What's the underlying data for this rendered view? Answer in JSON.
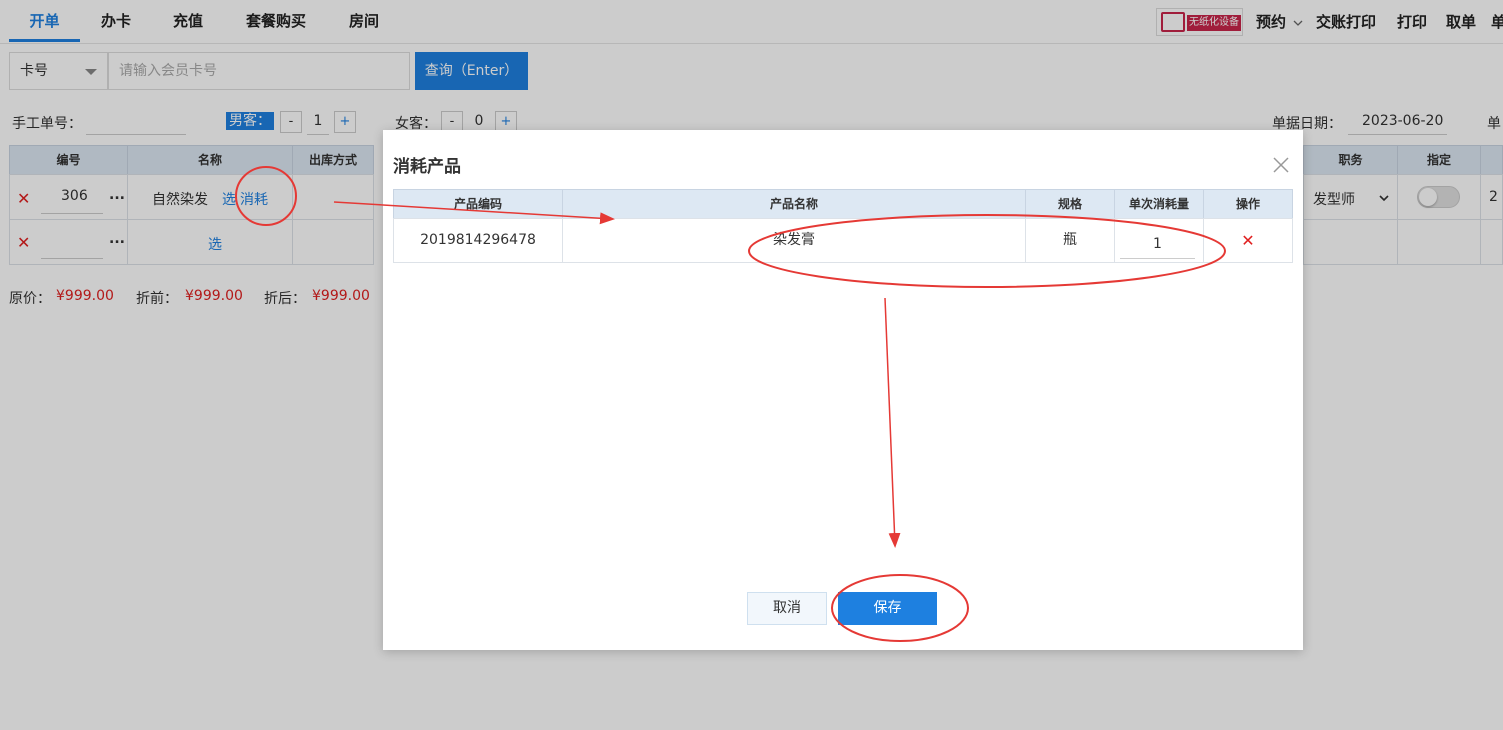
{
  "tabs": [
    "开单",
    "办卡",
    "充值",
    "套餐购买",
    "房间"
  ],
  "right_menu": {
    "promo_text": "无纸化设备",
    "appointment": "预约",
    "checkout_print": "交账打印",
    "print": "打印",
    "take_order": "取单",
    "cut_off": "单"
  },
  "search": {
    "type_value": "卡号",
    "placeholder": "请输入会员卡号",
    "button": "查询（Enter）"
  },
  "form": {
    "manual_no_label": "手工单号：",
    "male_label": "男客：",
    "male_count": "1",
    "female_label": "女客：",
    "female_count": "0",
    "minus": "-",
    "plus": "+",
    "date_label": "单据日期：",
    "date_value": "2023-06-20",
    "cut_label": "单"
  },
  "table": {
    "headers": [
      "编号",
      "名称",
      "出库方式",
      "职务",
      "指定"
    ],
    "rows": [
      {
        "code": "306",
        "name": "自然染发",
        "select": "选",
        "consume": "消耗",
        "position": "发型师",
        "edge": "2"
      },
      {
        "code": "",
        "name": "",
        "select": "选"
      }
    ],
    "more": "..."
  },
  "totals": {
    "original_label": "原价：",
    "original": "¥999.00",
    "before_label": "折前：",
    "before": "¥999.00",
    "after_label": "折后：",
    "after": "¥999.00"
  },
  "modal": {
    "title": "消耗产品",
    "headers": [
      "产品编码",
      "产品名称",
      "规格",
      "单次消耗量",
      "操作"
    ],
    "rows": [
      {
        "code": "2019814296478",
        "name": "染发膏",
        "spec": "瓶",
        "qty": "1"
      }
    ],
    "cancel": "取消",
    "save": "保存"
  },
  "colors": {
    "primary": "#1e80e0",
    "danger": "#e02020",
    "annotation": "#e53935"
  }
}
